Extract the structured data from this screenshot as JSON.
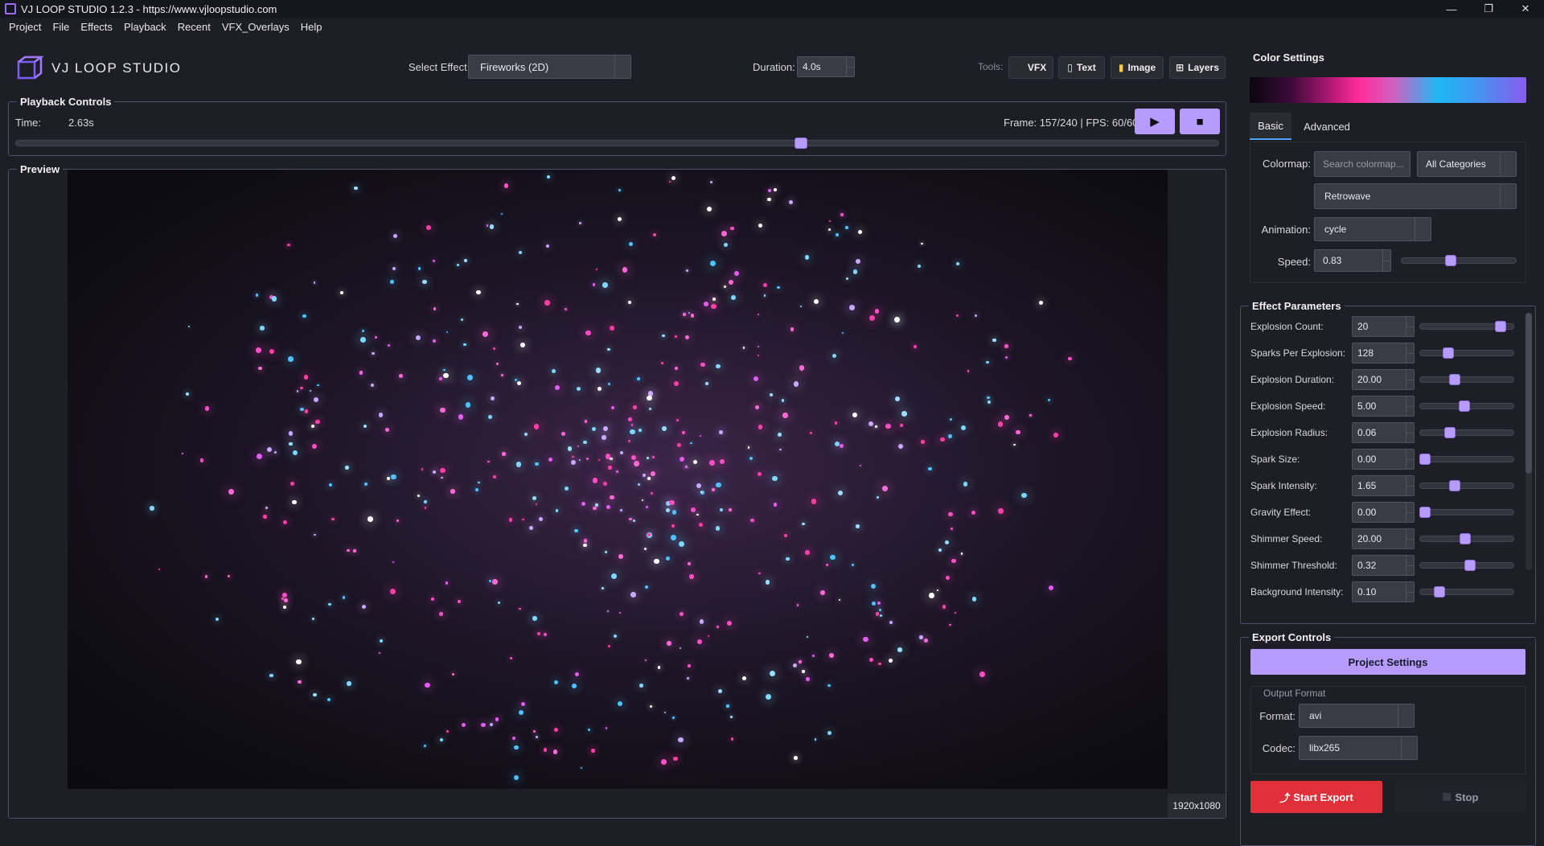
{
  "window": {
    "title": "VJ LOOP STUDIO 1.2.3 - https://www.vjloopstudio.com",
    "controls": [
      "—",
      "❐",
      "✕"
    ]
  },
  "menu": [
    "Project",
    "File",
    "Effects",
    "Playback",
    "Recent",
    "VFX_Overlays",
    "Help"
  ],
  "brand": {
    "name": "VJ LOOP STUDIO"
  },
  "toolbar": {
    "select_effect_label": "Select Effect:",
    "select_effect_value": "Fireworks (2D)",
    "duration_label": "Duration:",
    "duration_value": "4.0s",
    "tools_label": "Tools:",
    "tools": [
      {
        "label": "VFX",
        "icon": "vfx-icon",
        "glyph": "✦"
      },
      {
        "label": "Text",
        "icon": "text-icon",
        "glyph": "▯"
      },
      {
        "label": "Image",
        "icon": "image-icon",
        "glyph": "▮"
      },
      {
        "label": "Layers",
        "icon": "layers-icon",
        "glyph": "⊞"
      }
    ]
  },
  "playback": {
    "title": "Playback Controls",
    "time_label": "Time:",
    "time_value": "2.63s",
    "frame_info": "Frame: 157/240 | FPS: 60/60",
    "progress": 0.654,
    "play_glyph": "▶",
    "stop_glyph": "■"
  },
  "preview": {
    "title": "Preview",
    "resolution": "1920x1080"
  },
  "color_settings": {
    "title": "Color Settings",
    "tabs": [
      "Basic",
      "Advanced"
    ],
    "active_tab": "Basic",
    "colormap_label": "Colormap:",
    "search_placeholder": "Search colormap...",
    "category_value": "All Categories",
    "colormap_value": "Retrowave",
    "animation_label": "Animation:",
    "animation_value": "cycle",
    "speed_label": "Speed:",
    "speed_value": "0.83",
    "speed_level": 0.42
  },
  "effect_parameters": {
    "title": "Effect Parameters",
    "params": [
      {
        "label": "Explosion Count:",
        "value": "20",
        "level": 0.9
      },
      {
        "label": "Sparks Per Explosion:",
        "value": "128",
        "level": 0.28
      },
      {
        "label": "Explosion Duration:",
        "value": "20.00",
        "level": 0.36
      },
      {
        "label": "Explosion Speed:",
        "value": "5.00",
        "level": 0.47
      },
      {
        "label": "Explosion Radius:",
        "value": "0.06",
        "level": 0.3
      },
      {
        "label": "Spark Size:",
        "value": "0.00",
        "level": 0.0
      },
      {
        "label": "Spark Intensity:",
        "value": "1.65",
        "level": 0.36
      },
      {
        "label": "Gravity Effect:",
        "value": "0.00",
        "level": 0.0
      },
      {
        "label": "Shimmer Speed:",
        "value": "20.00",
        "level": 0.48
      },
      {
        "label": "Shimmer Threshold:",
        "value": "0.32",
        "level": 0.54
      },
      {
        "label": "Background Intensity:",
        "value": "0.10",
        "level": 0.17
      }
    ]
  },
  "export_controls": {
    "title": "Export Controls",
    "project_settings_label": "Project Settings",
    "output_format_label": "Output Format",
    "format_label": "Format:",
    "format_value": "avi",
    "codec_label": "Codec:",
    "codec_value": "libx265",
    "start_export_label": "Start Export",
    "stop_label": "Stop"
  },
  "colors": {
    "accent": "#b69cff",
    "export_red": "#e0303a",
    "panel_bg": "#1e1f26"
  }
}
